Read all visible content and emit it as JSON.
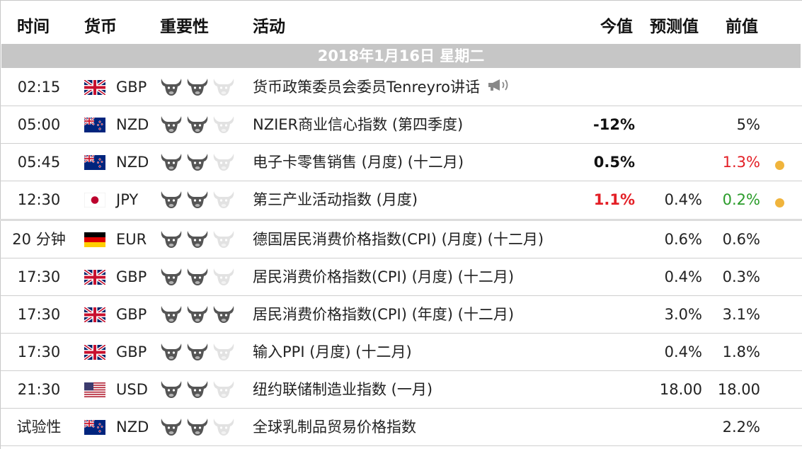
{
  "header": {
    "time": "时间",
    "currency": "货币",
    "importance": "重要性",
    "event": "活动",
    "actual": "今值",
    "forecast": "预测值",
    "previous": "前值"
  },
  "date_label": "2018年1月16日 星期二",
  "colors": {
    "bull_active": "#555555",
    "bull_inactive": "#e2e2e2",
    "positive": "#2a9c2a",
    "negative": "#e31f26",
    "dot": "#f0b43c"
  },
  "rows": [
    {
      "time": "02:15",
      "flag": "uk-flag-icon",
      "currency": "GBP",
      "importance": 2,
      "event": "货币政策委员会委员Tenreyro讲话",
      "speech": true,
      "actual": "",
      "actual_tone": "",
      "forecast": "",
      "previous": "",
      "previous_tone": "",
      "dot": false
    },
    {
      "time": "05:00",
      "flag": "nz-flag-icon",
      "currency": "NZD",
      "importance": 2,
      "event": "NZIER商业信心指数 (第四季度)",
      "speech": false,
      "actual": "-12%",
      "actual_tone": "black",
      "forecast": "",
      "previous": "5%",
      "previous_tone": "",
      "dot": false
    },
    {
      "time": "05:45",
      "flag": "nz-flag-icon",
      "currency": "NZD",
      "importance": 2,
      "event": "电子卡零售销售 (月度) (十二月)",
      "speech": false,
      "actual": "0.5%",
      "actual_tone": "black",
      "forecast": "",
      "previous": "1.3%",
      "previous_tone": "red",
      "dot": true
    },
    {
      "time": "12:30",
      "flag": "jp-flag-icon",
      "currency": "JPY",
      "importance": 2,
      "event": "第三产业活动指数 (月度)",
      "speech": false,
      "actual": "1.1%",
      "actual_tone": "red",
      "forecast": "0.4%",
      "previous": "0.2%",
      "previous_tone": "green",
      "dot": true
    },
    {
      "time": "20 分钟",
      "flag": "de-flag-icon",
      "currency": "EUR",
      "importance": 2,
      "event": "德国居民消费价格指数(CPI) (月度) (十二月)",
      "speech": false,
      "actual": "",
      "actual_tone": "",
      "forecast": "0.6%",
      "previous": "0.6%",
      "previous_tone": "",
      "dot": false
    },
    {
      "time": "17:30",
      "flag": "uk-flag-icon",
      "currency": "GBP",
      "importance": 2,
      "event": "居民消费价格指数(CPI) (月度) (十二月)",
      "speech": false,
      "actual": "",
      "actual_tone": "",
      "forecast": "0.4%",
      "previous": "0.3%",
      "previous_tone": "",
      "dot": false
    },
    {
      "time": "17:30",
      "flag": "uk-flag-icon",
      "currency": "GBP",
      "importance": 3,
      "event": "居民消费价格指数(CPI) (年度) (十二月)",
      "speech": false,
      "actual": "",
      "actual_tone": "",
      "forecast": "3.0%",
      "previous": "3.1%",
      "previous_tone": "",
      "dot": false
    },
    {
      "time": "17:30",
      "flag": "uk-flag-icon",
      "currency": "GBP",
      "importance": 2,
      "event": "输入PPI (月度) (十二月)",
      "speech": false,
      "actual": "",
      "actual_tone": "",
      "forecast": "0.4%",
      "previous": "1.8%",
      "previous_tone": "",
      "dot": false
    },
    {
      "time": "21:30",
      "flag": "us-flag-icon",
      "currency": "USD",
      "importance": 2,
      "event": "纽约联储制造业指数 (一月)",
      "speech": false,
      "actual": "",
      "actual_tone": "",
      "forecast": "18.00",
      "previous": "18.00",
      "previous_tone": "",
      "dot": false
    },
    {
      "time": "试验性",
      "flag": "nz-flag-icon",
      "currency": "NZD",
      "importance": 2,
      "event": "全球乳制品贸易价格指数",
      "speech": false,
      "actual": "",
      "actual_tone": "",
      "forecast": "",
      "previous": "2.2%",
      "previous_tone": "",
      "dot": false
    }
  ]
}
